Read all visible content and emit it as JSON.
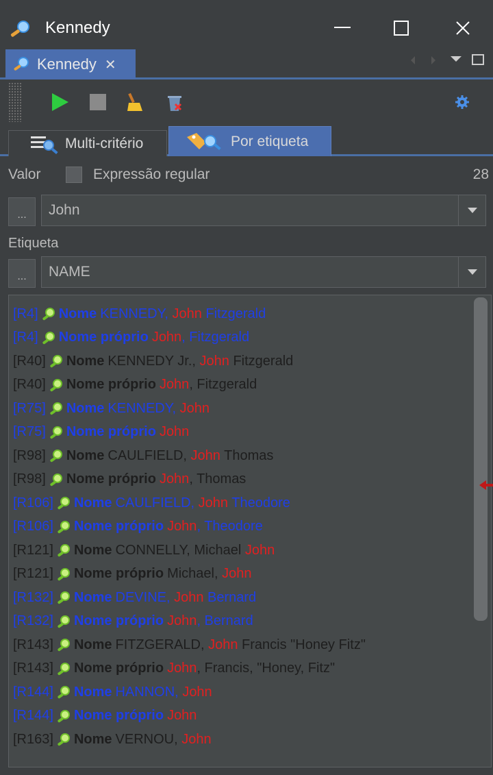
{
  "window": {
    "title": "Kennedy"
  },
  "doc_tab": {
    "label": "Kennedy",
    "close": "✕"
  },
  "toolbar": {
    "icons": [
      "play-icon",
      "stop-icon",
      "broom-icon",
      "trash-icon",
      "settings-icon"
    ]
  },
  "subtabs": [
    {
      "label": "Multi-critério",
      "selected": false
    },
    {
      "label": "Por etiqueta",
      "selected": true
    }
  ],
  "search": {
    "valor_label": "Valor",
    "regex_label": "Expressão regular",
    "regex_checked": false,
    "count": "28",
    "value_button": "...",
    "value": "John",
    "etiqueta_label": "Etiqueta",
    "tag_button": "...",
    "tag": "NAME"
  },
  "colors": {
    "match": "#e12020",
    "highlight_row": "#1f3fe6",
    "normal_row": "#1e1e1e",
    "accent": "#4b6eaf"
  },
  "results": [
    {
      "id": "[R4]",
      "field": "Nome",
      "style": "blue",
      "parts": [
        [
          "KENNEDY, ",
          false
        ],
        [
          "John",
          true
        ],
        [
          " Fitzgerald",
          false
        ]
      ]
    },
    {
      "id": "[R4]",
      "field": "Nome próprio",
      "style": "blue",
      "parts": [
        [
          "John",
          true
        ],
        [
          ", Fitzgerald",
          false
        ]
      ]
    },
    {
      "id": "[R40]",
      "field": "Nome",
      "style": "black",
      "parts": [
        [
          "KENNEDY Jr., ",
          false
        ],
        [
          "John",
          true
        ],
        [
          " Fitzgerald",
          false
        ]
      ]
    },
    {
      "id": "[R40]",
      "field": "Nome próprio",
      "style": "black",
      "parts": [
        [
          "John",
          true
        ],
        [
          ", Fitzgerald",
          false
        ]
      ]
    },
    {
      "id": "[R75]",
      "field": "Nome",
      "style": "blue",
      "parts": [
        [
          "KENNEDY, ",
          false
        ],
        [
          "John",
          true
        ]
      ]
    },
    {
      "id": "[R75]",
      "field": "Nome próprio",
      "style": "blue",
      "parts": [
        [
          "John",
          true
        ]
      ]
    },
    {
      "id": "[R98]",
      "field": "Nome",
      "style": "black",
      "parts": [
        [
          "CAULFIELD, ",
          false
        ],
        [
          "John",
          true
        ],
        [
          " Thomas",
          false
        ]
      ]
    },
    {
      "id": "[R98]",
      "field": "Nome próprio",
      "style": "black",
      "parts": [
        [
          "John",
          true
        ],
        [
          ", Thomas",
          false
        ]
      ]
    },
    {
      "id": "[R106]",
      "field": "Nome",
      "style": "blue",
      "parts": [
        [
          "CAULFIELD, ",
          false
        ],
        [
          "John",
          true
        ],
        [
          " Theodore",
          false
        ]
      ]
    },
    {
      "id": "[R106]",
      "field": "Nome próprio",
      "style": "blue",
      "parts": [
        [
          "John",
          true
        ],
        [
          ", Theodore",
          false
        ]
      ]
    },
    {
      "id": "[R121]",
      "field": "Nome",
      "style": "black",
      "parts": [
        [
          "CONNELLY, Michael ",
          false
        ],
        [
          "John",
          true
        ]
      ]
    },
    {
      "id": "[R121]",
      "field": "Nome próprio",
      "style": "black",
      "parts": [
        [
          "Michael, ",
          false
        ],
        [
          "John",
          true
        ]
      ]
    },
    {
      "id": "[R132]",
      "field": "Nome",
      "style": "blue",
      "parts": [
        [
          "DEVINE, ",
          false
        ],
        [
          "John",
          true
        ],
        [
          " Bernard",
          false
        ]
      ]
    },
    {
      "id": "[R132]",
      "field": "Nome próprio",
      "style": "blue",
      "parts": [
        [
          "John",
          true
        ],
        [
          ", Bernard",
          false
        ]
      ]
    },
    {
      "id": "[R143]",
      "field": "Nome",
      "style": "black",
      "parts": [
        [
          "FITZGERALD, ",
          false
        ],
        [
          "John",
          true
        ],
        [
          " Francis \"Honey Fitz\"",
          false
        ]
      ]
    },
    {
      "id": "[R143]",
      "field": "Nome próprio",
      "style": "black",
      "parts": [
        [
          "John",
          true
        ],
        [
          ", Francis, \"Honey, Fitz\"",
          false
        ]
      ]
    },
    {
      "id": "[R144]",
      "field": "Nome",
      "style": "blue",
      "parts": [
        [
          "HANNON, ",
          false
        ],
        [
          "John",
          true
        ]
      ]
    },
    {
      "id": "[R144]",
      "field": "Nome próprio",
      "style": "blue",
      "parts": [
        [
          "John",
          true
        ]
      ]
    },
    {
      "id": "[R163]",
      "field": "Nome",
      "style": "black",
      "parts": [
        [
          "VERNOU, ",
          false
        ],
        [
          "John",
          true
        ]
      ]
    }
  ]
}
